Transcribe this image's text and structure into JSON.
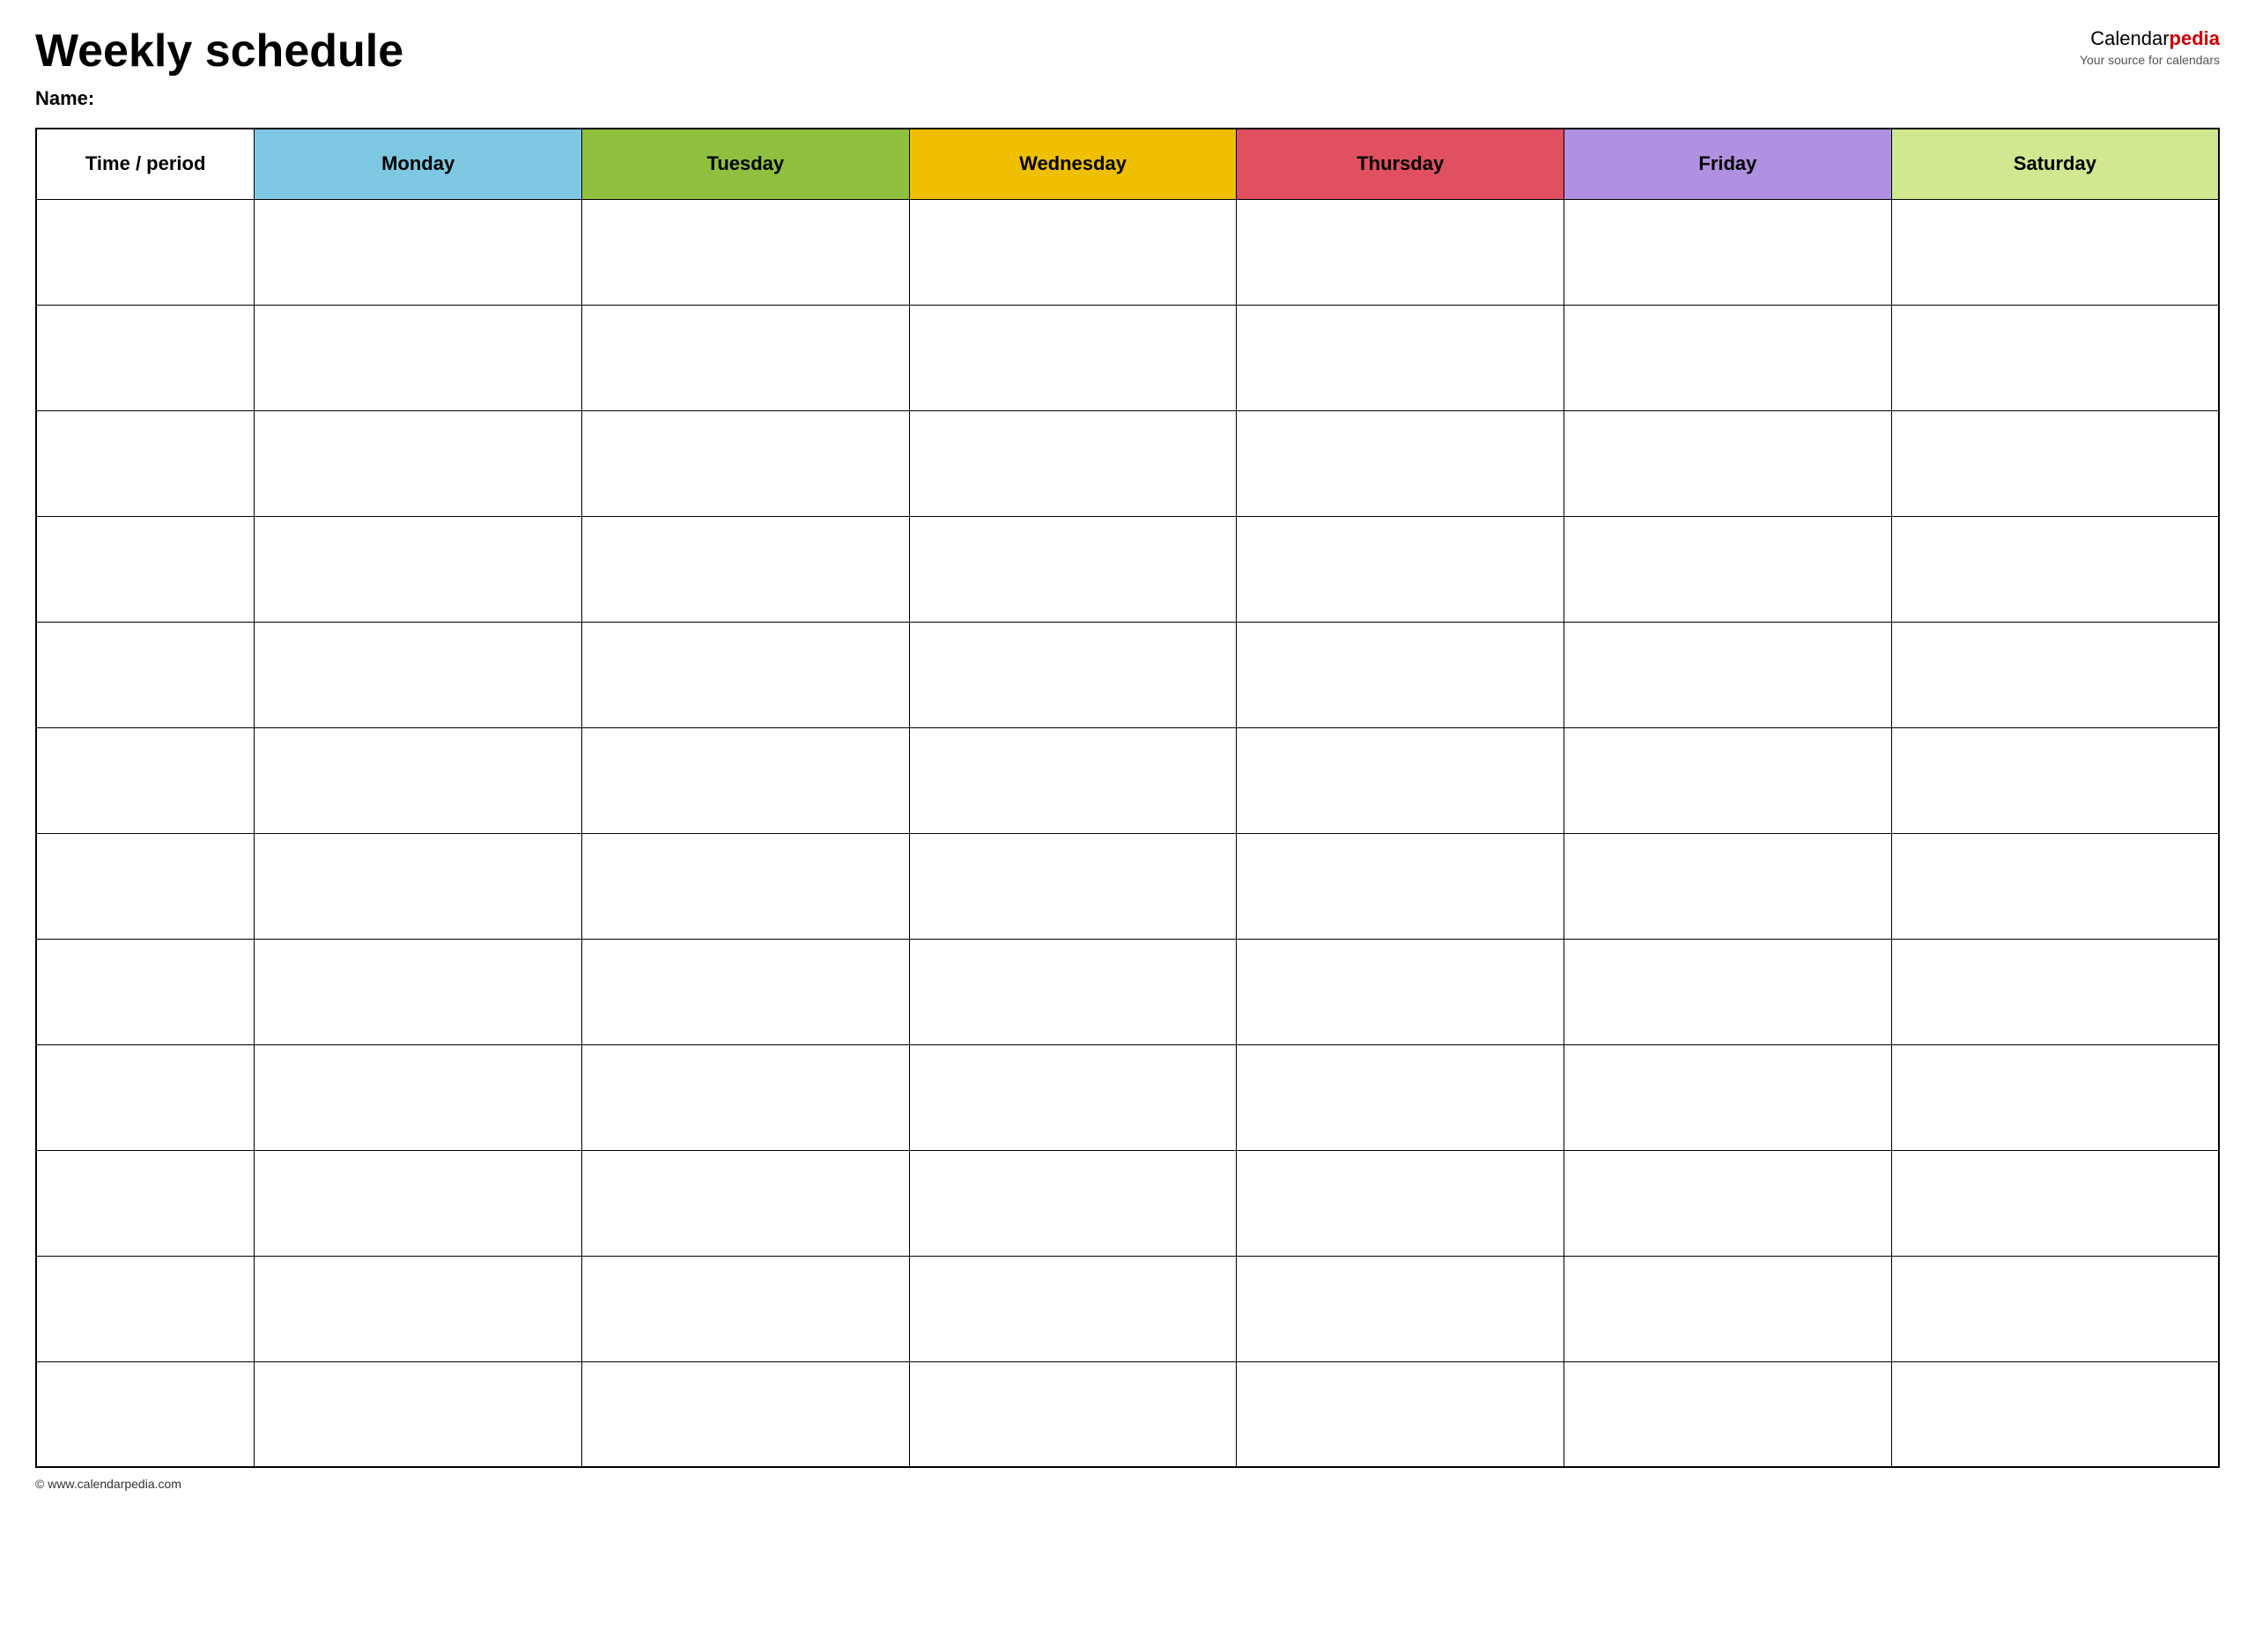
{
  "header": {
    "main_title": "Weekly schedule",
    "name_label": "Name:",
    "logo": {
      "calendar_text": "Calendar",
      "pedia_text": "pedia",
      "tagline": "Your source for calendars"
    }
  },
  "table": {
    "columns": [
      {
        "id": "time",
        "label": "Time / period",
        "color": "#ffffff"
      },
      {
        "id": "monday",
        "label": "Monday",
        "color": "#7ec8e3"
      },
      {
        "id": "tuesday",
        "label": "Tuesday",
        "color": "#90c040"
      },
      {
        "id": "wednesday",
        "label": "Wednesday",
        "color": "#f0c000"
      },
      {
        "id": "thursday",
        "label": "Thursday",
        "color": "#e05060"
      },
      {
        "id": "friday",
        "label": "Friday",
        "color": "#b090e0"
      },
      {
        "id": "saturday",
        "label": "Saturday",
        "color": "#d0e890"
      }
    ],
    "row_count": 12
  },
  "footer": {
    "url": "© www.calendarpedia.com"
  }
}
